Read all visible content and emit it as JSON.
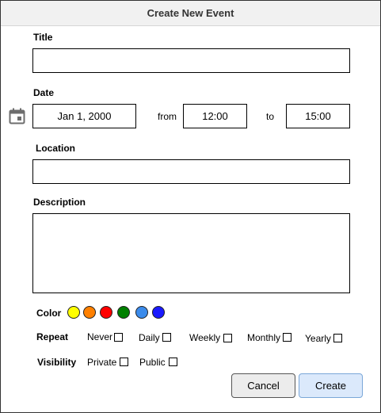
{
  "dialog": {
    "title": "Create New Event"
  },
  "form": {
    "title_label": "Title",
    "title_value": "",
    "date_label": "Date",
    "date_value": "Jan 1, 2000",
    "from_label": "from",
    "from_value": "12:00",
    "to_label": "to",
    "to_value": "15:00",
    "location_label": "Location",
    "location_value": "",
    "description_label": "Description",
    "description_value": ""
  },
  "color": {
    "label": "Color",
    "swatches": [
      "#ffff00",
      "#ff8000",
      "#ff0000",
      "#008000",
      "#3b8beb",
      "#1a1aff"
    ]
  },
  "repeat": {
    "label": "Repeat",
    "options": [
      "Never",
      "Daily",
      "Weekly",
      "Monthly",
      "Yearly"
    ]
  },
  "visibility": {
    "label": "Visibility",
    "options": [
      "Private",
      "Public"
    ]
  },
  "buttons": {
    "cancel": "Cancel",
    "create": "Create"
  },
  "icons": {
    "calendar": "calendar-icon"
  }
}
